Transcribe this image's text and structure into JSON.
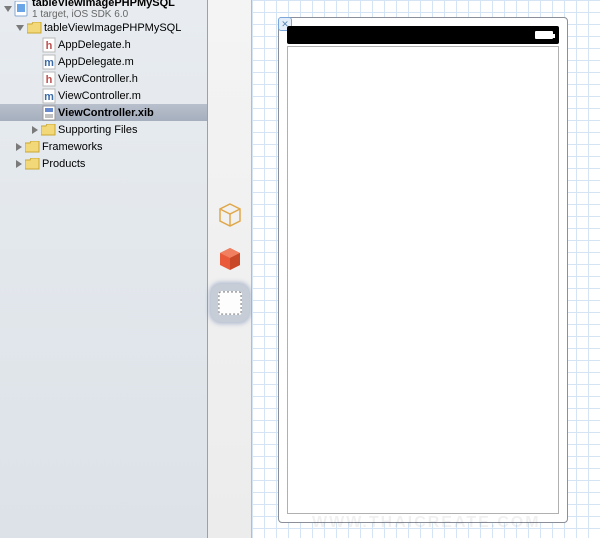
{
  "project": {
    "name": "tableViewImagePHPMySQL",
    "subtitle": "1 target, iOS SDK 6.0"
  },
  "tree": {
    "root_folder": "tableViewImagePHPMySQL",
    "files": {
      "appdelegate_h": "AppDelegate.h",
      "appdelegate_m": "AppDelegate.m",
      "viewcontroller_h": "ViewController.h",
      "viewcontroller_m": "ViewController.m",
      "viewcontroller_xib": "ViewController.xib"
    },
    "folders": {
      "supporting": "Supporting Files",
      "frameworks": "Frameworks",
      "products": "Products"
    }
  },
  "watermark": "WWW.THAICREATE.COM"
}
